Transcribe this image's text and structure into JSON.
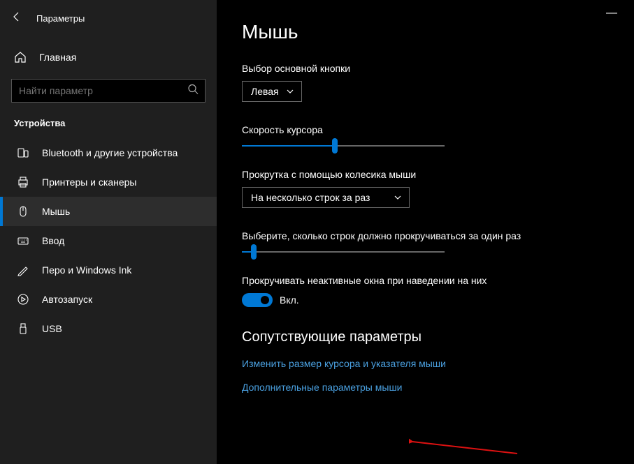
{
  "window": {
    "title": "Параметры"
  },
  "sidebar": {
    "home": "Главная",
    "search_placeholder": "Найти параметр",
    "category": "Устройства",
    "items": [
      {
        "label": "Bluetooth и другие устройства"
      },
      {
        "label": "Принтеры и сканеры"
      },
      {
        "label": "Мышь"
      },
      {
        "label": "Ввод"
      },
      {
        "label": "Перо и Windows Ink"
      },
      {
        "label": "Автозапуск"
      },
      {
        "label": "USB"
      }
    ]
  },
  "main": {
    "title": "Мышь",
    "primary_button": {
      "label": "Выбор основной кнопки",
      "value": "Левая"
    },
    "cursor_speed": {
      "label": "Скорость курсора",
      "value_pct": 46
    },
    "scroll_mode": {
      "label": "Прокрутка с помощью колесика мыши",
      "value": "На несколько строк за раз"
    },
    "scroll_lines": {
      "label": "Выберите, сколько строк должно прокручиваться за один раз",
      "value_pct": 6
    },
    "inactive_scroll": {
      "label": "Прокручивать неактивные окна при наведении на них",
      "on": true,
      "on_label": "Вкл."
    },
    "related": {
      "title": "Сопутствующие параметры",
      "link1": "Изменить размер курсора и указателя мыши",
      "link2": "Дополнительные параметры мыши"
    }
  }
}
